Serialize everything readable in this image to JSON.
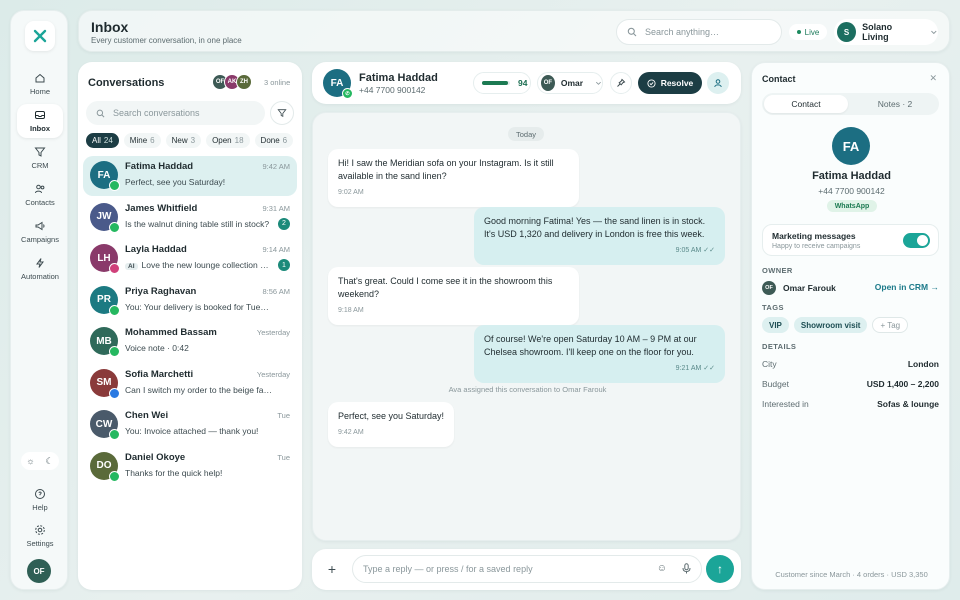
{
  "rail": {
    "logo": "X",
    "items": [
      {
        "label": "Home",
        "icon": "home-icon"
      },
      {
        "label": "Inbox",
        "icon": "inbox-icon"
      },
      {
        "label": "CRM",
        "icon": "funnel-icon"
      },
      {
        "label": "Contacts",
        "icon": "users-icon"
      },
      {
        "label": "Campaigns",
        "icon": "megaphone-icon"
      },
      {
        "label": "Automation",
        "icon": "bolt-icon"
      }
    ],
    "help": "Help",
    "settings": "Settings",
    "me": "OF"
  },
  "header": {
    "title": "Inbox",
    "subtitle": "Every customer conversation, in one place",
    "search_placeholder": "Search anything…",
    "live": "Live",
    "workspace": "Solano Living",
    "workspace_initial": "S"
  },
  "conversations": {
    "title": "Conversations",
    "team": [
      "OF",
      "AK",
      "ZH"
    ],
    "online": "3 online",
    "search_placeholder": "Search conversations",
    "filters": [
      {
        "label": "All",
        "count": "24"
      },
      {
        "label": "Mine",
        "count": "6"
      },
      {
        "label": "New",
        "count": "3"
      },
      {
        "label": "Open",
        "count": "18"
      },
      {
        "label": "Done",
        "count": "6"
      }
    ],
    "items": [
      {
        "initials": "FA",
        "name": "Fatima Haddad",
        "time": "9:42 AM",
        "preview": "Perfect, see you Saturday!",
        "unread": "",
        "color": "#1c6e82",
        "channel": "whatsapp"
      },
      {
        "initials": "JW",
        "name": "James Whitfield",
        "time": "9:31 AM",
        "preview": "Is the walnut dining table still in stock?",
        "unread": "2",
        "color": "#4a5a8a",
        "channel": "whatsapp"
      },
      {
        "initials": "LH",
        "name": "Layla Haddad",
        "time": "9:14 AM",
        "preview": "Love the new lounge collection …",
        "ai": "AI",
        "unread": "1",
        "color": "#8a3a6a",
        "channel": "instagram"
      },
      {
        "initials": "PR",
        "name": "Priya Raghavan",
        "time": "8:56 AM",
        "preview": "You: Your delivery is booked for Tuesday",
        "unread": "",
        "color": "#1c7a82",
        "channel": "whatsapp"
      },
      {
        "initials": "MB",
        "name": "Mohammed Bassam",
        "time": "Yesterday",
        "preview": "Voice note · 0:42",
        "unread": "",
        "color": "#2f6a5a",
        "channel": "whatsapp"
      },
      {
        "initials": "SM",
        "name": "Sofia Marchetti",
        "time": "Yesterday",
        "preview": "Can I switch my order to the beige fabric?",
        "unread": "",
        "color": "#8a3a3a",
        "channel": "messenger"
      },
      {
        "initials": "CW",
        "name": "Chen Wei",
        "time": "Tue",
        "preview": "You: Invoice attached — thank you!",
        "unread": "",
        "color": "#4a5a6a",
        "channel": "whatsapp"
      },
      {
        "initials": "DO",
        "name": "Daniel Okoye",
        "time": "Tue",
        "preview": "Thanks for the quick help!",
        "unread": "",
        "color": "#5a6a3a",
        "channel": "whatsapp"
      }
    ]
  },
  "chat": {
    "initials": "FA",
    "name": "Fatima Haddad",
    "phone": "+44 7700 900142",
    "score": "94",
    "score_fraction": 0.94,
    "assignee": "Omar",
    "assignee_initials": "OF",
    "resolve": "Resolve",
    "day": "Today",
    "messages": [
      {
        "dir": "in",
        "text": "Hi! I saw the Meridian sofa on your Instagram. Is it still available in the sand linen?",
        "time": "9:02 AM"
      },
      {
        "dir": "out",
        "text": "Good morning Fatima! Yes — the sand linen is in stock. It's USD 1,320 and delivery in London is free this week.",
        "time": "9:05 AM ✓✓"
      },
      {
        "dir": "in",
        "text": "That's great. Could I come see it in the showroom this weekend?",
        "time": "9:18 AM"
      },
      {
        "dir": "out",
        "text": "Of course! We're open Saturday 10 AM – 9 PM at our Chelsea showroom. I'll keep one on the floor for you.",
        "time": "9:21 AM ✓✓"
      },
      {
        "dir": "in",
        "text": "Perfect, see you Saturday!",
        "time": "9:42 AM"
      }
    ],
    "system_note": "Ava assigned this conversation to Omar Farouk",
    "composer_placeholder": "Type a reply — or press / for a saved reply"
  },
  "contact": {
    "title": "Contact",
    "tab_contact": "Contact",
    "tab_notes": "Notes · 2",
    "initials": "FA",
    "name": "Fatima Haddad",
    "phone": "+44 7700 900142",
    "channel": "WhatsApp",
    "marketing_title": "Marketing messages",
    "marketing_sub": "Happy to receive campaigns",
    "owner_label": "OWNER",
    "owner_initials": "OF",
    "owner": "Omar Farouk",
    "crm_link": "Open in CRM →",
    "tags_label": "TAGS",
    "tags": [
      "VIP",
      "Showroom visit"
    ],
    "add_tag": "+ Tag",
    "details_label": "DETAILS",
    "details": [
      {
        "k": "City",
        "v": "London"
      },
      {
        "k": "Budget",
        "v": "USD 1,400 – 2,200"
      },
      {
        "k": "Interested in",
        "v": "Sofas & lounge"
      }
    ],
    "footer": "Customer since March · 4 orders · USD 3,350"
  }
}
